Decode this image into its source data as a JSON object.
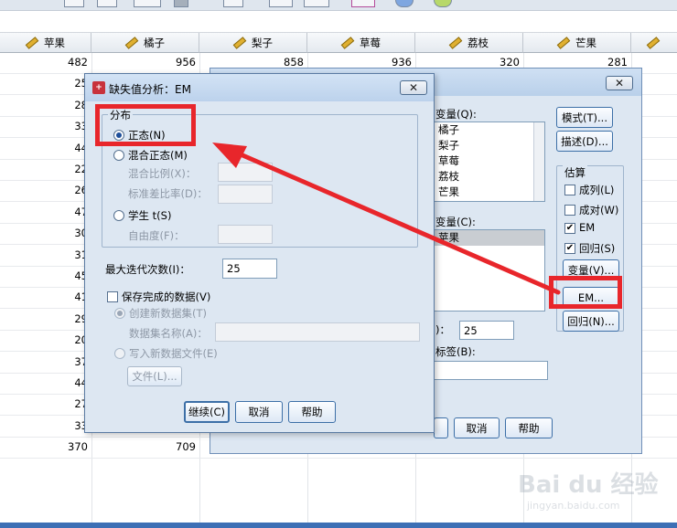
{
  "columns": [
    "苹果",
    "橘子",
    "梨子",
    "草莓",
    "荔枝",
    "芒果"
  ],
  "apple_values": [
    "482",
    "25",
    "28",
    "33",
    "44",
    "22",
    "26",
    "47",
    "30",
    "31",
    "45",
    "41",
    "29",
    "20",
    "37",
    "44",
    "27",
    "33",
    "370"
  ],
  "orange_visible": {
    "row0": "956",
    "row18": "709"
  },
  "row0_values": [
    "858",
    "936",
    "320",
    "281"
  ],
  "main_dialog": {
    "variables_label": "变量(Q):",
    "variables_list": [
      "橘子",
      "梨子",
      "草莓",
      "荔枝",
      "芒果"
    ],
    "category_label": "变量(C):",
    "category_list": [
      "苹果"
    ],
    "iter_value": "25",
    "label_text": "标签(B):",
    "buttons": {
      "patterns": "模式(T)...",
      "describe": "描述(D)...",
      "variables": "变量(V)...",
      "em": "EM...",
      "regression": "回归(N)..."
    },
    "estimate_group": "估算",
    "estimate_items": [
      {
        "label": "成列(L)",
        "checked": false
      },
      {
        "label": "成对(W)",
        "checked": false
      },
      {
        "label": "EM",
        "checked": true
      },
      {
        "label": "回归(S)",
        "checked": true
      }
    ],
    "cancel": "取消",
    "help": "帮助",
    "close_glyph": "✕"
  },
  "em_dialog": {
    "title": "缺失值分析：EM",
    "distribution_group": "分布",
    "normal": "正态(N)",
    "mixed_normal": "混合正态(M)",
    "mixing_ratio": "混合比例(X)：",
    "std_ratio": "标准差比率(D)：",
    "student_t": "学生 t(S)",
    "df": "自由度(F)：",
    "max_iter_label": "最大迭代次数(I)：",
    "max_iter_value": "25",
    "save_completed": "保存完成的数据(V)",
    "create_dataset": "创建新数据集(T)",
    "dataset_name": "数据集名称(A)：",
    "write_file": "写入新数据文件(E)",
    "file_button": "文件(L)...",
    "continue": "继续(C)",
    "cancel": "取消",
    "help": "帮助",
    "close_glyph": "✕"
  },
  "watermark": {
    "main": "Bai du 经验",
    "sub": "jingyan.baidu.com"
  },
  "colors": {
    "highlight": "#e8262b",
    "dialog_bg": "#dde7f2",
    "button_border": "#3c6fa7"
  }
}
